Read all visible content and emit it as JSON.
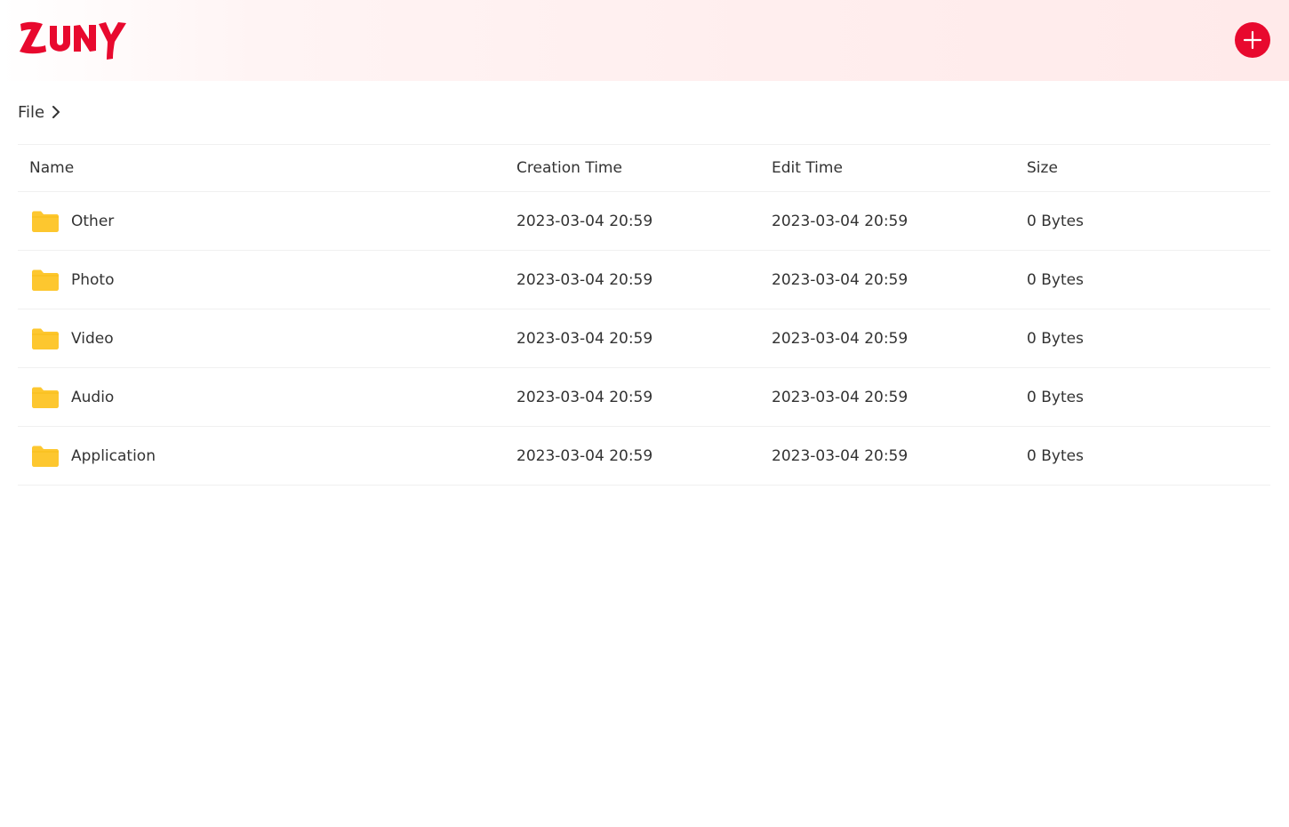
{
  "header": {
    "logo_text": "ZUNY",
    "brand_color": "#e8092e",
    "add_icon": "plus-icon"
  },
  "breadcrumb": {
    "items": [
      {
        "label": "File"
      }
    ],
    "separator_icon": "chevron-right-icon"
  },
  "table": {
    "columns": [
      "Name",
      "Creation Time",
      "Edit Time",
      "Size"
    ],
    "folder_icon": "folder-icon",
    "folder_color": "#fdc72f",
    "rows": [
      {
        "name": "Other",
        "creation_time": "2023-03-04 20:59",
        "edit_time": "2023-03-04 20:59",
        "size": "0 Bytes"
      },
      {
        "name": "Photo",
        "creation_time": "2023-03-04 20:59",
        "edit_time": "2023-03-04 20:59",
        "size": "0 Bytes"
      },
      {
        "name": "Video",
        "creation_time": "2023-03-04 20:59",
        "edit_time": "2023-03-04 20:59",
        "size": "0 Bytes"
      },
      {
        "name": "Audio",
        "creation_time": "2023-03-04 20:59",
        "edit_time": "2023-03-04 20:59",
        "size": "0 Bytes"
      },
      {
        "name": "Application",
        "creation_time": "2023-03-04 20:59",
        "edit_time": "2023-03-04 20:59",
        "size": "0 Bytes"
      }
    ]
  }
}
